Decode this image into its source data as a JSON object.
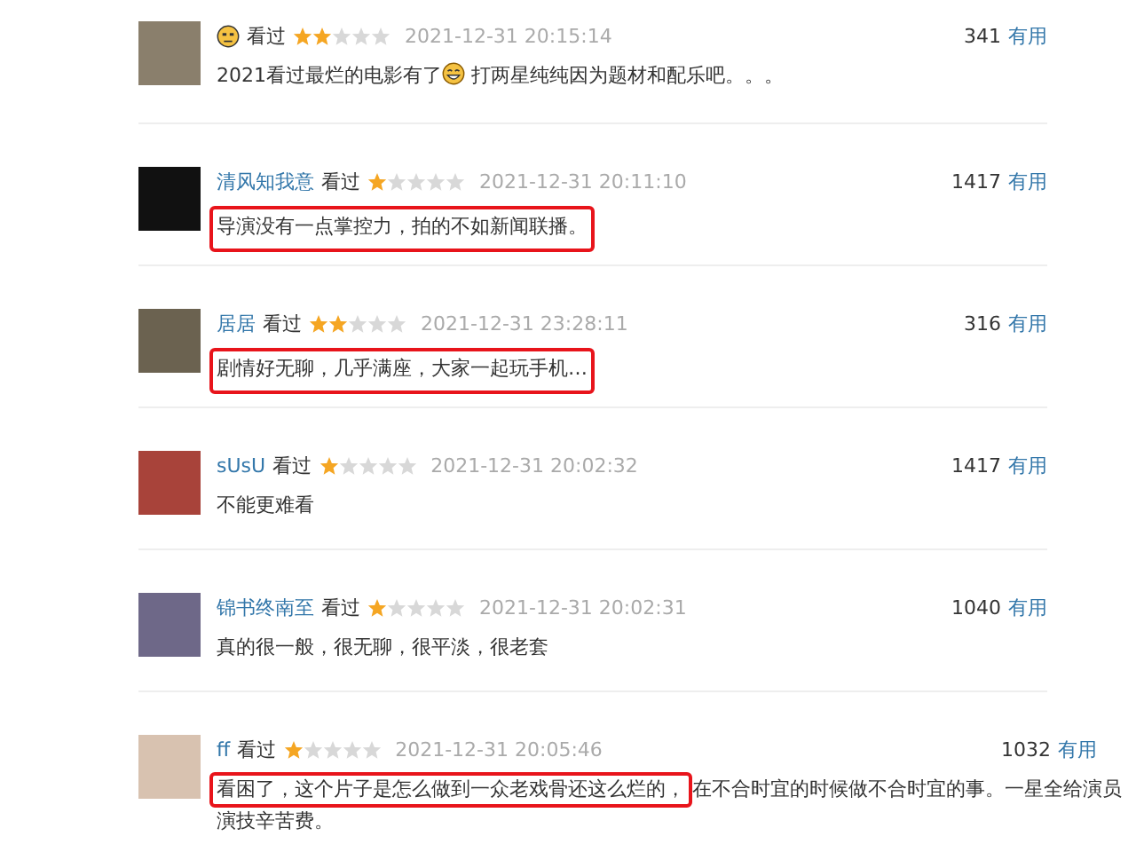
{
  "comments": [
    {
      "status": "看过",
      "stars": 2,
      "time": "2021-12-31 20:15:14",
      "votes": "341",
      "useful": "有用",
      "segments": [
        {
          "kind": "text",
          "text": "2021看过最烂的电影有了",
          "highlighted": false
        },
        {
          "kind": "emoji"
        },
        {
          "kind": "text",
          "text": " 打两星纯纯因为题材和配乐吧。。。",
          "highlighted": false
        }
      ]
    },
    {
      "username": "清风知我意",
      "status": "看过",
      "stars": 1,
      "time": "2021-12-31 20:11:10",
      "votes": "1417",
      "useful": "有用",
      "segments": [
        {
          "kind": "text",
          "text": "导演没有一点掌控力，拍的不如新闻联播。",
          "highlighted": true
        }
      ]
    },
    {
      "username": "居居",
      "status": "看过",
      "stars": 2,
      "time": "2021-12-31 23:28:11",
      "votes": "316",
      "useful": "有用",
      "segments": [
        {
          "kind": "text",
          "text": "剧情好无聊，几乎满座，大家一起玩手机…",
          "highlighted": true
        }
      ]
    },
    {
      "username": "sUsU",
      "status": "看过",
      "stars": 1,
      "time": "2021-12-31 20:02:32",
      "votes": "1417",
      "useful": "有用",
      "segments": [
        {
          "kind": "text",
          "text": "不能更难看",
          "highlighted": false
        }
      ]
    },
    {
      "username": "锦书终南至",
      "status": "看过",
      "stars": 1,
      "time": "2021-12-31 20:02:31",
      "votes": "1040",
      "useful": "有用",
      "segments": [
        {
          "kind": "text",
          "text": "真的很一般，很无聊，很平淡，很老套",
          "highlighted": false
        }
      ]
    },
    {
      "username": "ff",
      "status": "看过",
      "stars": 1,
      "time": "2021-12-31 20:05:46",
      "votes": "1032",
      "useful": "有用",
      "segments": [
        {
          "kind": "text",
          "text": "看困了，这个片子是怎么做到一众老戏骨还这么烂的，",
          "highlighted": true
        },
        {
          "kind": "text",
          "text": "在不合时宜的时候做不合时宜的事。一星全给演员演技辛苦费。",
          "highlighted": false
        }
      ]
    }
  ]
}
